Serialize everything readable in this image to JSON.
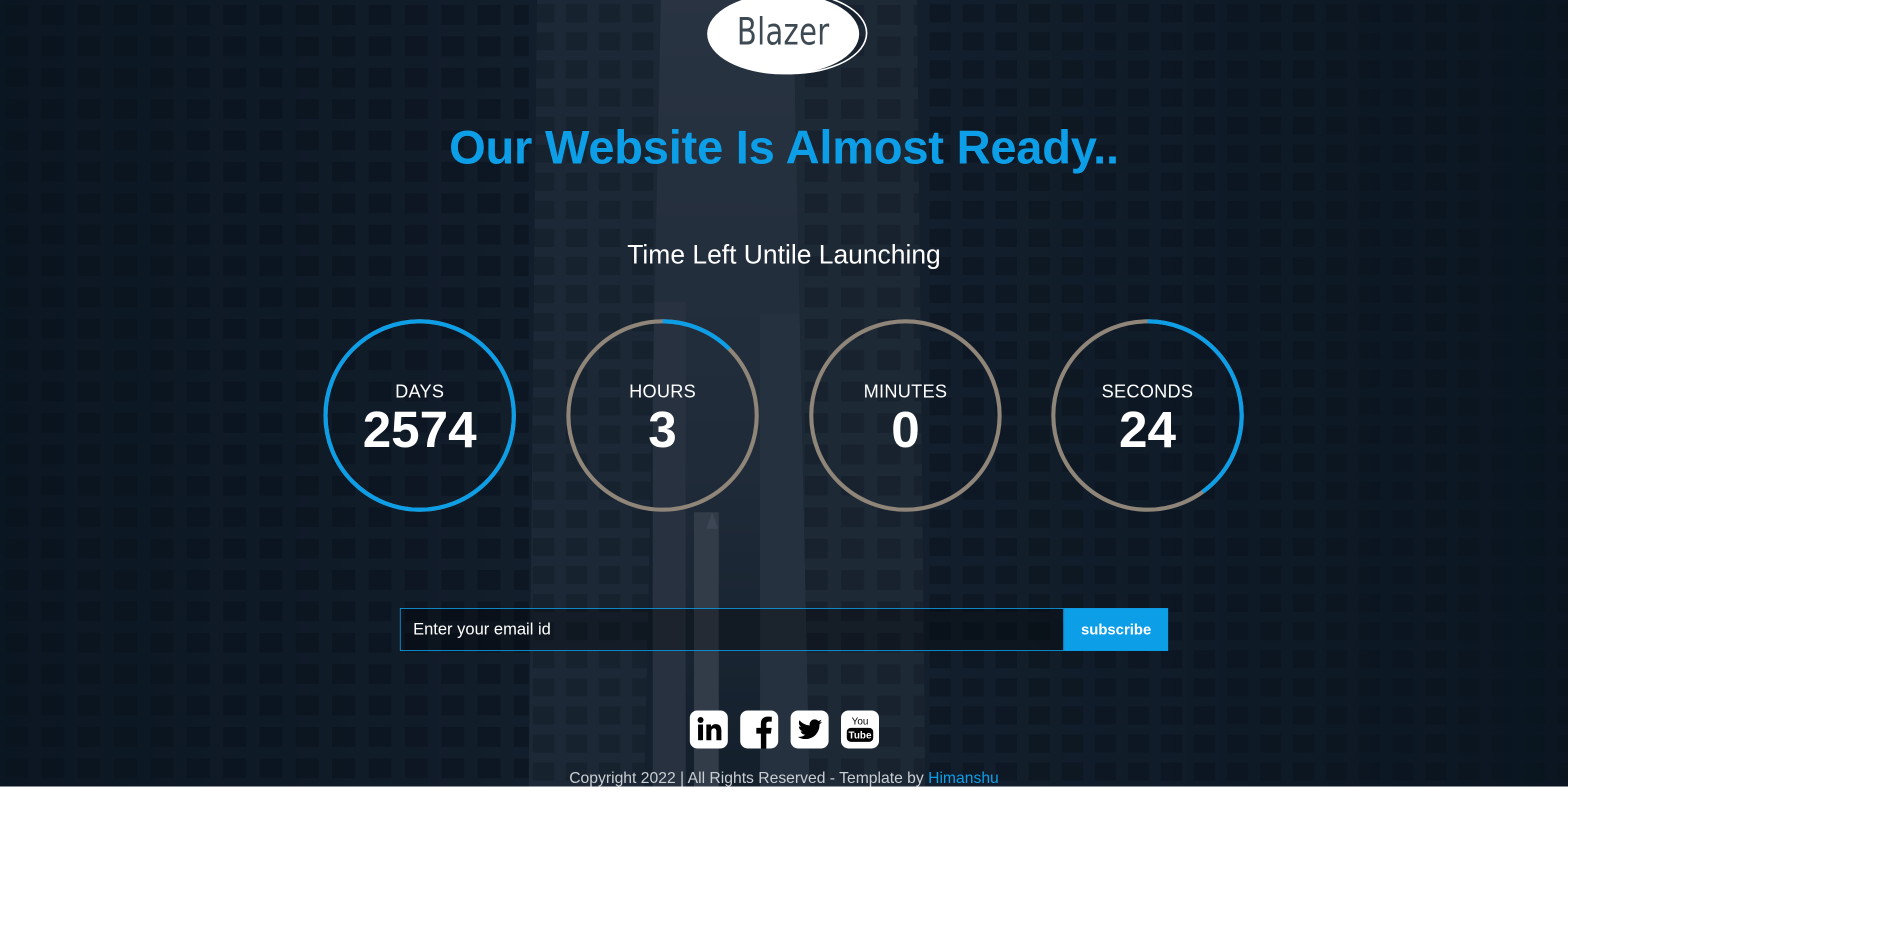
{
  "brand": {
    "logo_text": "Blazer"
  },
  "hero": {
    "headline": "Our Website Is Almost Ready..",
    "subheadline": "Time Left Untile Launching"
  },
  "countdown": [
    {
      "unit": "DAYS",
      "value": "2574",
      "progress": 1.0
    },
    {
      "unit": "HOURS",
      "value": "3",
      "progress": 0.125
    },
    {
      "unit": "MINUTES",
      "value": "0",
      "progress": 0.0
    },
    {
      "unit": "SECONDS",
      "value": "24",
      "progress": 0.4
    }
  ],
  "colors": {
    "accent": "#0d9ee8",
    "ring_track": "#8f8578",
    "text": "#ffffff"
  },
  "subscribe": {
    "email_placeholder": "Enter your email id",
    "button_label": "subscribe"
  },
  "social": [
    {
      "icon": "linkedin-icon",
      "label": "in"
    },
    {
      "icon": "facebook-icon",
      "label": "f"
    },
    {
      "icon": "twitter-icon",
      "label": ""
    },
    {
      "icon": "youtube-icon",
      "label": "You Tube"
    }
  ],
  "footer": {
    "copyright": "Copyright 2022 | All Rights Reserved - Template by",
    "author_link": "Himanshu"
  }
}
